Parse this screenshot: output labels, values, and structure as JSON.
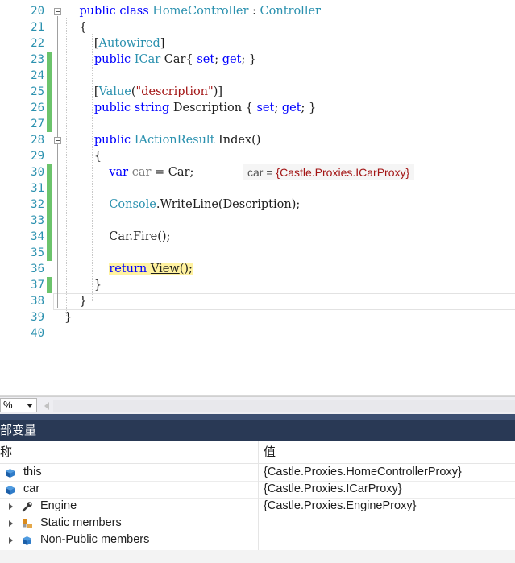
{
  "editor": {
    "lines": [
      {
        "num": "20",
        "changed": false,
        "parts": [
          {
            "t": "    ",
            "c": ""
          },
          {
            "t": "public",
            "c": "kw"
          },
          {
            "t": " ",
            "c": ""
          },
          {
            "t": "class",
            "c": "kw"
          },
          {
            "t": " ",
            "c": ""
          },
          {
            "t": "HomeController",
            "c": "ty"
          },
          {
            "t": " : ",
            "c": ""
          },
          {
            "t": "Controller",
            "c": "ty"
          }
        ]
      },
      {
        "num": "21",
        "changed": false,
        "parts": [
          {
            "t": "    {",
            "c": ""
          }
        ]
      },
      {
        "num": "22",
        "changed": false,
        "parts": [
          {
            "t": "        [",
            "c": ""
          },
          {
            "t": "Autowired",
            "c": "ty"
          },
          {
            "t": "]",
            "c": ""
          }
        ]
      },
      {
        "num": "23",
        "changed": true,
        "parts": [
          {
            "t": "        ",
            "c": ""
          },
          {
            "t": "public",
            "c": "kw"
          },
          {
            "t": " ",
            "c": ""
          },
          {
            "t": "ICar",
            "c": "ty"
          },
          {
            "t": " Car{ ",
            "c": ""
          },
          {
            "t": "set",
            "c": "kw"
          },
          {
            "t": "; ",
            "c": ""
          },
          {
            "t": "get",
            "c": "kw"
          },
          {
            "t": "; }",
            "c": ""
          }
        ]
      },
      {
        "num": "24",
        "changed": true,
        "parts": []
      },
      {
        "num": "25",
        "changed": true,
        "parts": [
          {
            "t": "        [",
            "c": ""
          },
          {
            "t": "Value",
            "c": "ty"
          },
          {
            "t": "(",
            "c": ""
          },
          {
            "t": "\"description\"",
            "c": "st"
          },
          {
            "t": ")]",
            "c": ""
          }
        ]
      },
      {
        "num": "26",
        "changed": true,
        "parts": [
          {
            "t": "        ",
            "c": ""
          },
          {
            "t": "public",
            "c": "kw"
          },
          {
            "t": " ",
            "c": ""
          },
          {
            "t": "string",
            "c": "kw"
          },
          {
            "t": " Description { ",
            "c": ""
          },
          {
            "t": "set",
            "c": "kw"
          },
          {
            "t": "; ",
            "c": ""
          },
          {
            "t": "get",
            "c": "kw"
          },
          {
            "t": "; }",
            "c": ""
          }
        ]
      },
      {
        "num": "27",
        "changed": true,
        "parts": []
      },
      {
        "num": "28",
        "changed": false,
        "parts": [
          {
            "t": "        ",
            "c": ""
          },
          {
            "t": "public",
            "c": "kw"
          },
          {
            "t": " ",
            "c": ""
          },
          {
            "t": "IActionResult",
            "c": "ty"
          },
          {
            "t": " Index()",
            "c": ""
          }
        ]
      },
      {
        "num": "29",
        "changed": false,
        "parts": [
          {
            "t": "        {",
            "c": ""
          }
        ]
      },
      {
        "num": "30",
        "changed": true,
        "parts": [
          {
            "t": "            ",
            "c": ""
          },
          {
            "t": "var",
            "c": "kw"
          },
          {
            "t": " ",
            "c": ""
          },
          {
            "t": "car",
            "c": "dim"
          },
          {
            "t": " = Car;",
            "c": ""
          }
        ]
      },
      {
        "num": "31",
        "changed": true,
        "parts": []
      },
      {
        "num": "32",
        "changed": true,
        "parts": [
          {
            "t": "            ",
            "c": ""
          },
          {
            "t": "Console",
            "c": "ty"
          },
          {
            "t": ".WriteLine(Description);",
            "c": ""
          }
        ]
      },
      {
        "num": "33",
        "changed": true,
        "parts": []
      },
      {
        "num": "34",
        "changed": true,
        "parts": [
          {
            "t": "            Car.Fire();",
            "c": ""
          }
        ]
      },
      {
        "num": "35",
        "changed": true,
        "parts": []
      },
      {
        "num": "36",
        "changed": false,
        "parts": [
          {
            "t": "            ",
            "c": ""
          },
          {
            "t": "return",
            "c": "kw hl"
          },
          {
            "t": " ",
            "c": "hl"
          },
          {
            "t": "View",
            "c": "hl under"
          },
          {
            "t": "();",
            "c": "hl"
          }
        ]
      },
      {
        "num": "37",
        "changed": true,
        "parts": [
          {
            "t": "        }",
            "c": ""
          }
        ]
      },
      {
        "num": "38",
        "changed": false,
        "parts": [
          {
            "t": "    }",
            "c": ""
          }
        ]
      },
      {
        "num": "39",
        "changed": false,
        "parts": [
          {
            "t": "}",
            "c": ""
          }
        ]
      },
      {
        "num": "40",
        "changed": false,
        "parts": []
      }
    ],
    "datatip": {
      "name": "car",
      "eq": " = ",
      "value": "{Castle.Proxies.ICarProxy}"
    }
  },
  "zoom": {
    "value": "%"
  },
  "locals_panel": {
    "title": "部变量",
    "col_name": "称",
    "col_value": "值",
    "rows": [
      {
        "name": "this",
        "value": "{Castle.Proxies.HomeControllerProxy}",
        "icon": "object-icon",
        "expandable": false,
        "indent": 0
      },
      {
        "name": "car",
        "value": "{Castle.Proxies.ICarProxy}",
        "icon": "object-icon",
        "expandable": false,
        "indent": 0
      },
      {
        "name": "Engine",
        "value": "{Castle.Proxies.EngineProxy}",
        "icon": "wrench-property-icon",
        "expandable": true,
        "indent": 1
      },
      {
        "name": "Static members",
        "value": "",
        "icon": "static-members-icon",
        "expandable": true,
        "indent": 1
      },
      {
        "name": "Non-Public members",
        "value": "",
        "icon": "object-icon",
        "expandable": true,
        "indent": 1
      }
    ]
  },
  "colors": {
    "keyword": "#0000ff",
    "type": "#2b91af",
    "string": "#a31515",
    "change_bar": "#6cc36c",
    "panel_title_bg": "#293955",
    "highlight": "#fff2a0"
  }
}
